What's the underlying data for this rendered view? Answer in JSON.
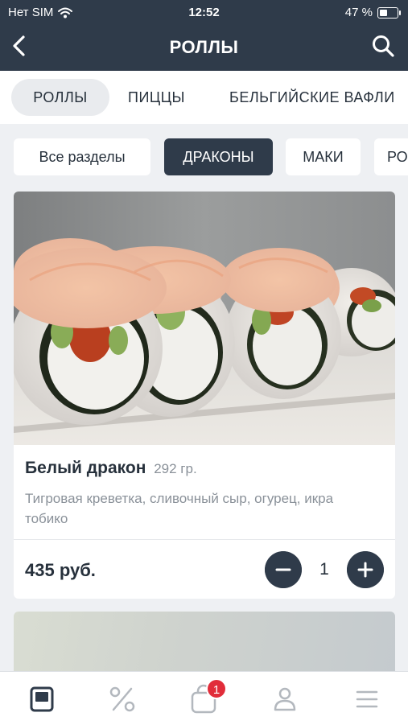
{
  "status_bar": {
    "carrier": "Нет SIM",
    "time": "12:52",
    "battery": "47 %",
    "battery_level": 0.47
  },
  "header": {
    "title": "РОЛЛЫ"
  },
  "categories": [
    {
      "label": "РОЛЛЫ",
      "active": true
    },
    {
      "label": "ПИЦЦЫ",
      "active": false
    },
    {
      "label": "БЕЛЬГИЙСКИЕ ВАФЛИ",
      "active": false
    }
  ],
  "subcategories": [
    {
      "label": "Все разделы",
      "active": false
    },
    {
      "label": "ДРАКОНЫ",
      "active": true
    },
    {
      "label": "МАКИ",
      "active": false
    },
    {
      "label": "РО",
      "active": false
    }
  ],
  "product": {
    "name": "Белый дракон",
    "weight": "292 гр.",
    "description": "Тигровая креветка, сливочный сыр, огурец, икра тобико",
    "price": "435 руб.",
    "quantity": "1"
  },
  "tabbar": {
    "items": [
      "menu-icon",
      "percent-icon",
      "cart-icon",
      "profile-icon",
      "hamburger-icon"
    ],
    "cart_badge": "1"
  },
  "colors": {
    "header_bg": "#2f3b4a",
    "accent": "#2f3b4a",
    "badge": "#e12d3a",
    "muted_text": "#8a9199"
  }
}
